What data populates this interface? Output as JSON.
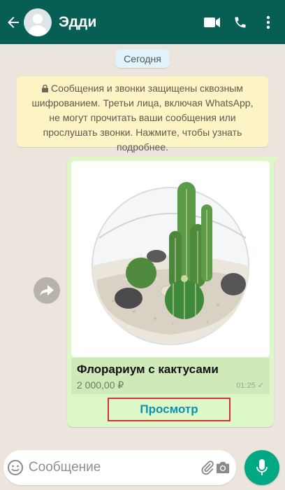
{
  "header": {
    "contact_name": "Эдди"
  },
  "chat": {
    "date_label": "Сегодня",
    "encryption_notice": "Сообщения и звонки защищены сквозным шифрованием. Третьи лица, включая WhatsApp, не могут прочитать ваши сообщения или прослушать звонки. Нажмите, чтобы узнать подробнее.",
    "product_message": {
      "title": "Флорариум с кактусами",
      "price": "2 000,00 ₽",
      "time": "01:25 ✓",
      "view_button_label": "Просмотр"
    }
  },
  "composer": {
    "placeholder": "Сообщение"
  },
  "colors": {
    "header": "#075e54",
    "bubble": "#dcf8c6",
    "accent": "#00a884",
    "highlight_border": "#d62f2f"
  },
  "icons": [
    "back-arrow-icon",
    "avatar-icon",
    "video-call-icon",
    "phone-icon",
    "more-icon",
    "lock-icon",
    "forward-icon",
    "emoji-icon",
    "attach-icon",
    "camera-icon",
    "mic-icon"
  ]
}
